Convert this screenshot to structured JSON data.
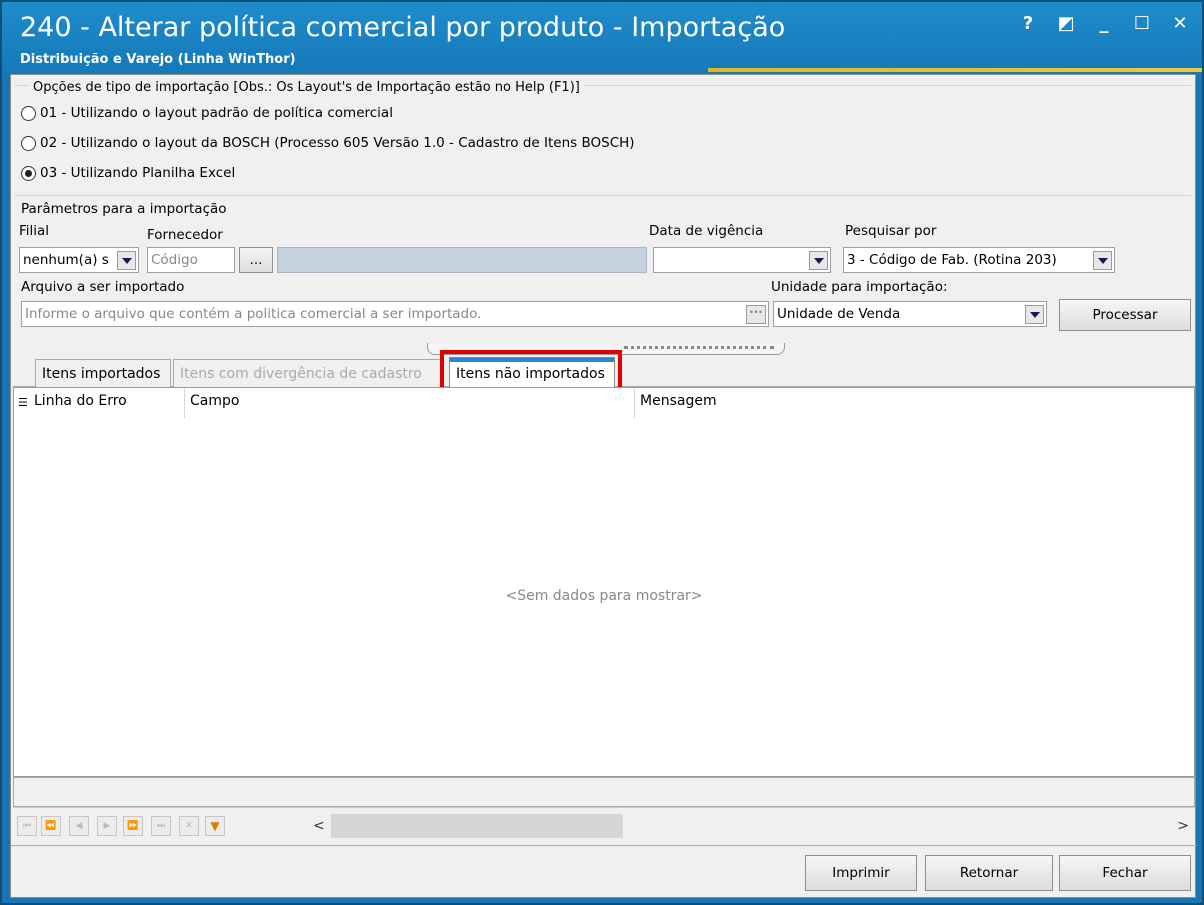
{
  "window": {
    "title": "240 - Alterar política comercial por produto - Importação",
    "subtitle": "Distribuição e Varejo (Linha WinThor)",
    "buttons": {
      "help": "?",
      "restore": "◩",
      "minimize": "_",
      "maximize": "☐",
      "close": "✕"
    }
  },
  "import_options": {
    "legend": "Opções de tipo de importação  [Obs.: Os Layout's de Importação estão no Help (F1)]",
    "options": [
      {
        "label": "01 - Utilizando o layout padrão de política comercial",
        "checked": false
      },
      {
        "label": "02 - Utilizando o layout da BOSCH (Processo 605 Versão 1.0 - Cadastro de Itens BOSCH)",
        "checked": false
      },
      {
        "label": "03 - Utilizando Planilha Excel",
        "checked": true
      }
    ]
  },
  "params": {
    "legend": "Parâmetros para a importação",
    "filial_label": "Filial",
    "filial_value": "nenhum(a) s",
    "fornecedor_label": "Fornecedor",
    "fornecedor_placeholder": "Código",
    "fornecedor_button": "...",
    "data_label": "Data de vigência",
    "data_value": "",
    "pesquisar_label": "Pesquisar por",
    "pesquisar_value": "3 - Código de Fab. (Rotina 203)",
    "arquivo_label": "Arquivo a ser importado",
    "arquivo_placeholder": "Informe o arquivo que contém a politica comercial a ser importado.",
    "arquivo_button": "···",
    "unidade_label": "Unidade para importação:",
    "unidade_value": "Unidade de Venda",
    "processar_label": "Processar"
  },
  "tabs": [
    {
      "label": "Itens importados",
      "state": "normal"
    },
    {
      "label": "Itens com divergência de cadastro",
      "state": "disabled"
    },
    {
      "label": "Itens não importados",
      "state": "active"
    }
  ],
  "grid": {
    "columns": [
      "Linha do Erro",
      "Campo",
      "Mensagem"
    ],
    "empty_message": "<Sem dados para mostrar>"
  },
  "navigator": {
    "buttons": [
      "first",
      "prev-page",
      "prev",
      "next",
      "next-page",
      "last",
      "cancel",
      "filter"
    ],
    "scroll_left": "<",
    "scroll_right": ">"
  },
  "footer": {
    "imprimir": "Imprimir",
    "retornar": "Retornar",
    "fechar": "Fechar"
  },
  "colors": {
    "titlebar": "#1f8ccc",
    "highlight": "#e00000",
    "active_tab_accent": "#2a86cf"
  }
}
